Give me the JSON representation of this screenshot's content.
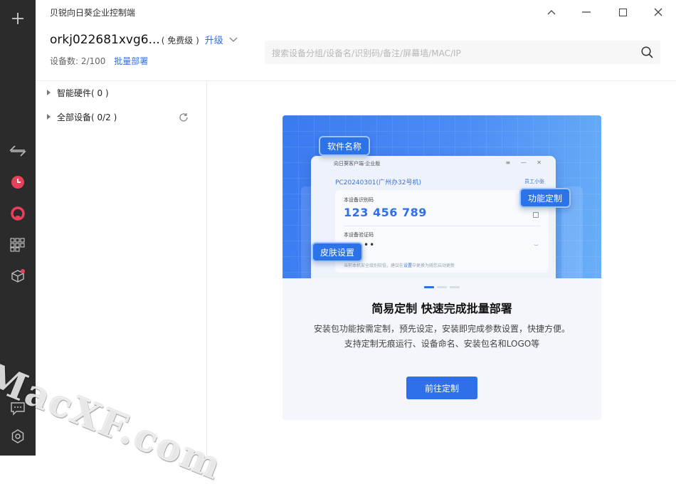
{
  "window": {
    "title": "贝锐向日葵企业控制端"
  },
  "account": {
    "name": "orkj022681xvg6...",
    "level": "( 免费级 )",
    "upgrade_label": "升级",
    "device_count": "设备数:  2/100",
    "batch_deploy_label": "批量部署"
  },
  "search": {
    "placeholder": "搜索设备分组/设备名/识别码/备注/屏幕墙/MAC/IP"
  },
  "tree": {
    "items": [
      {
        "label": "智能硬件( 0 )"
      },
      {
        "label": "全部设备( 0/2 )"
      }
    ]
  },
  "promo": {
    "mock_header": "向日葵客户端·企业版",
    "mock_pc_name": "PC20240301(广州办32号机)",
    "mock_staff": "员工小张",
    "mock_code_label": "本设备识别码",
    "mock_code": "123 456 789",
    "mock_verify_label": "本设备验证码",
    "mock_verify_dots": "••",
    "mock_footer_pre": "当前本机安全级别较低，建议在",
    "mock_footer_link": "设置",
    "mock_footer_post": "中更换为随您启动更新",
    "tag_software_name": "软件名称",
    "tag_function_custom": "功能定制",
    "tag_skin_setting": "皮肤设置",
    "title": "简易定制 快速完成批量部署",
    "desc_line1": "安装包功能按需定制，预先设定，安装即完成参数设置，快捷方便。",
    "desc_line2": "支持定制无痕运行、设备命名、安装包名和LOGO等",
    "cta_label": "前往定制"
  },
  "watermark": "MacXF.com",
  "colors": {
    "accent": "#2f6fe8",
    "rail": "#2b2b2b",
    "rail_active": "#e8405a"
  }
}
